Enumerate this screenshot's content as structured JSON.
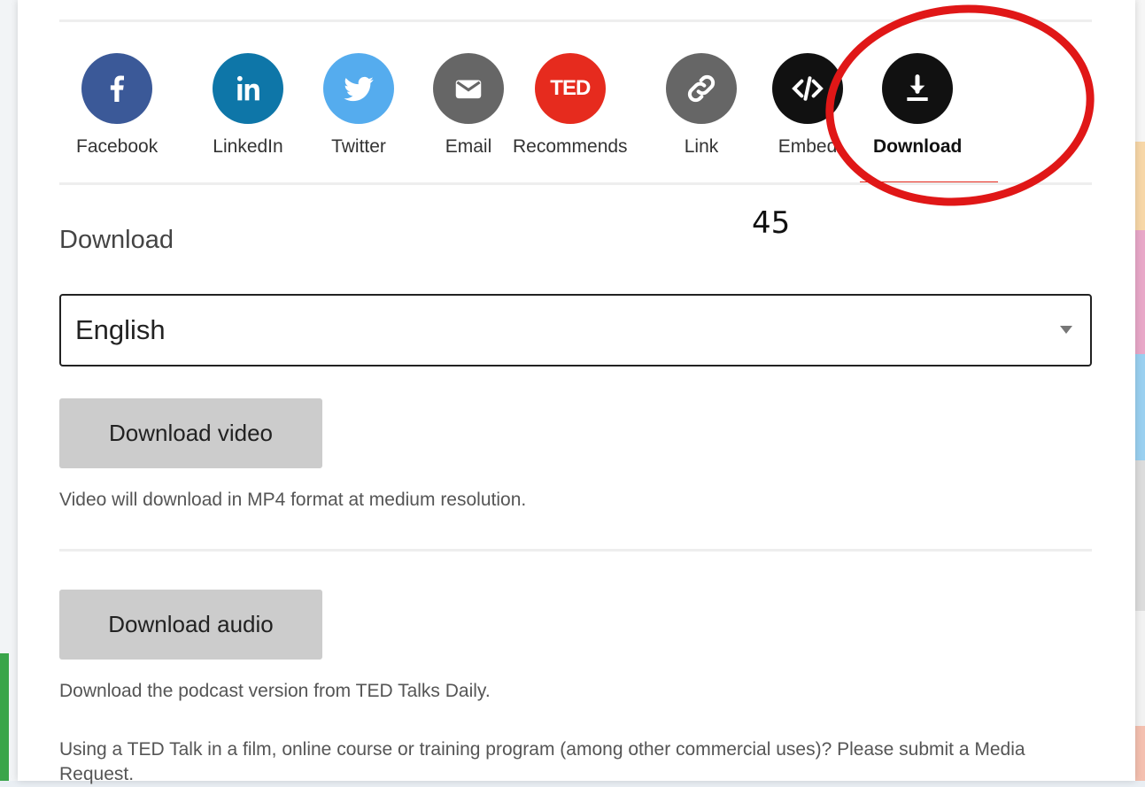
{
  "share": {
    "items": [
      {
        "label": "Facebook",
        "icon": "facebook-icon",
        "color": "#3b5998"
      },
      {
        "label": "LinkedIn",
        "icon": "linkedin-icon",
        "color": "#0e76a8"
      },
      {
        "label": "Twitter",
        "icon": "twitter-icon",
        "color": "#55acee"
      },
      {
        "label": "Email",
        "icon": "email-icon",
        "color": "#666666"
      },
      {
        "label": "Recommends",
        "icon": "ted-icon",
        "color": "#e62b1e",
        "badge": "TED"
      },
      {
        "label": "Link",
        "icon": "link-icon",
        "color": "#666666"
      },
      {
        "label": "Embed",
        "icon": "embed-icon",
        "color": "#111111"
      },
      {
        "label": "Download",
        "icon": "download-icon",
        "color": "#111111",
        "active": true
      }
    ],
    "accent": "#e62b1e"
  },
  "annotation": {
    "number": "45",
    "color": "#e01717"
  },
  "section": {
    "title": "Download"
  },
  "language_select": {
    "value": "English"
  },
  "video": {
    "button_label": "Download video",
    "note": "Video will download in MP4 format at medium resolution."
  },
  "audio": {
    "button_label": "Download audio",
    "note": "Download the podcast version from TED Talks Daily."
  },
  "footer": {
    "text": "Using a TED Talk in a film, online course or training program (among other commercial uses)? Please submit a Media Request."
  }
}
